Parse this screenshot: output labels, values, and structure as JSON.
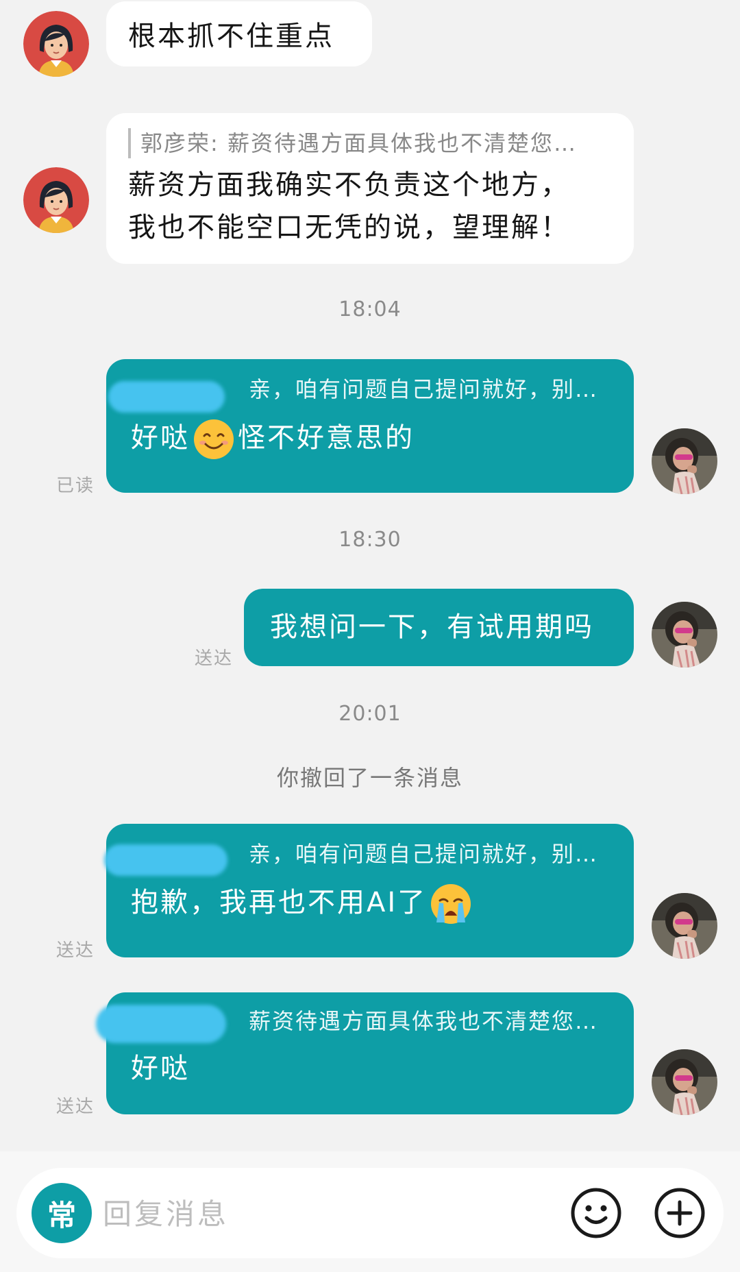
{
  "messages": [
    {
      "text": "根本抓不住重点"
    },
    {
      "quote": "郭彦荣: 薪资待遇方面具体我也不清楚您…",
      "lines": [
        "薪资方面我确实不负责这个地方，",
        "我也不能空口无凭的说，望理解！"
      ]
    },
    {
      "quote": "亲，咱有问题自己提问就好，别…",
      "text": "好哒",
      "text_after": "怪不好意思的",
      "status": "已读",
      "emoji": "smile-emoji"
    },
    {
      "text": "我想问一下，有试用期吗",
      "status": "送达"
    },
    {
      "quote": "亲，咱有问题自己提问就好，别…",
      "text": "抱歉，我再也不用AI了",
      "status": "送达",
      "emoji": "crying-emoji"
    },
    {
      "quote": "薪资待遇方面具体我也不清楚您…",
      "text": "好哒",
      "status": "送达"
    }
  ],
  "timestamps": [
    "18:04",
    "18:30",
    "20:01"
  ],
  "system_notice": "你撤回了一条消息",
  "input": {
    "quick_label": "常",
    "placeholder": "回复消息"
  },
  "colors": {
    "outgoing": "#0e9ea6",
    "incoming": "#ffffff",
    "background": "#f2f2f2",
    "redaction": "#46c3ef"
  }
}
